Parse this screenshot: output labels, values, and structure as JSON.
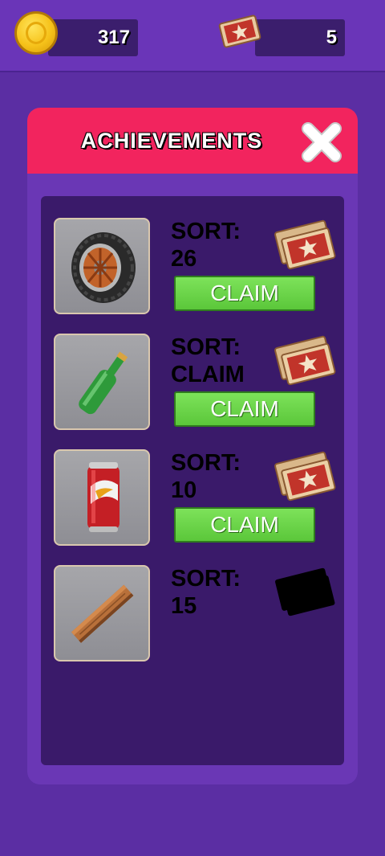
{
  "header": {
    "coins": "317",
    "tickets": "5"
  },
  "panel": {
    "title": "ACHIEVEMENTS"
  },
  "achievements": [
    {
      "item": "tire",
      "label_line1": "SORT:",
      "label_line2": "26",
      "button": "CLAIM",
      "reward_icon": "ticket-icon"
    },
    {
      "item": "bottle",
      "label_line1": "SORT:",
      "label_line2": "CLAIM",
      "button": "CLAIM",
      "reward_icon": "ticket-icon"
    },
    {
      "item": "can",
      "label_line1": "SORT:",
      "label_line2": "10",
      "button": "CLAIM",
      "reward_icon": "ticket-icon"
    },
    {
      "item": "plank",
      "label_line1": "SORT:",
      "label_line2": "15",
      "reward_icon": "locked-ticket-icon"
    }
  ],
  "colors": {
    "background": "#5b2ea3",
    "header_bar": "#f2245e",
    "claim_green": "#5bc73a",
    "list_bg": "#3a1a6a"
  }
}
